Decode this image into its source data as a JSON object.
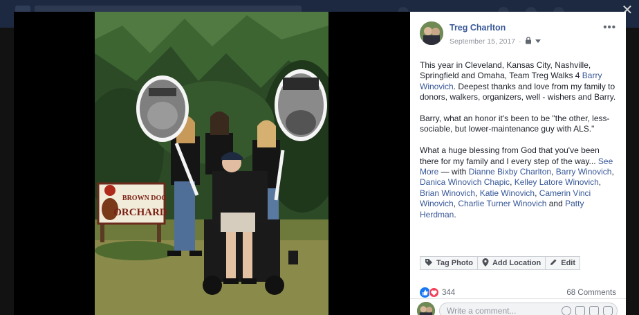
{
  "post": {
    "author": "Treg Charlton",
    "date": "September 15, 2017",
    "paragraph1_pre": "This year in Cleveland, Kansas City, Nashville, Springfield and Omaha, Team Treg Walks 4 ",
    "paragraph1_link": "Barry Winovich",
    "paragraph1_post": ". Deepest thanks and love from my family to donors, walkers, organizers, well - wishers and Barry.",
    "paragraph2": "Barry, what an honor it's been to be \"the other, less-sociable, but lower-maintenance guy with ALS.\"",
    "paragraph3": "What a huge blessing from God that you've been there for my family and I every step of the way...",
    "see_more": "See More",
    "with_prefix": " — with ",
    "tagged": [
      "Dianne Bixby Charlton",
      "Barry Winovich",
      "Danica Winovich Chapic",
      "Kelley Latore Winovich",
      "Brian Winovich",
      "Katie Winovich",
      "Camerin Vinci Winovich",
      "Charlie Turner Winovich"
    ],
    "and_word": " and ",
    "tagged_last": "Patty Herdman",
    "period": "."
  },
  "photo": {
    "sign_line1": "BROWN DOG",
    "sign_line2": "ORCHARD"
  },
  "actions": {
    "tag_photo": "Tag Photo",
    "add_location": "Add Location",
    "edit": "Edit"
  },
  "reactions": {
    "count": "344",
    "comments": "68 Comments"
  },
  "comment": {
    "placeholder": "Write a comment..."
  },
  "colors": {
    "link": "#385898",
    "like_blue": "#1877f2",
    "love_red": "#f33e58"
  },
  "icons": [
    "close-icon",
    "more-icon",
    "lock-icon",
    "chevron-down-icon",
    "tag-icon",
    "location-pin-icon",
    "pencil-icon",
    "like-icon",
    "love-icon",
    "emoji-icon",
    "camera-icon",
    "gif-icon",
    "sticker-icon"
  ]
}
